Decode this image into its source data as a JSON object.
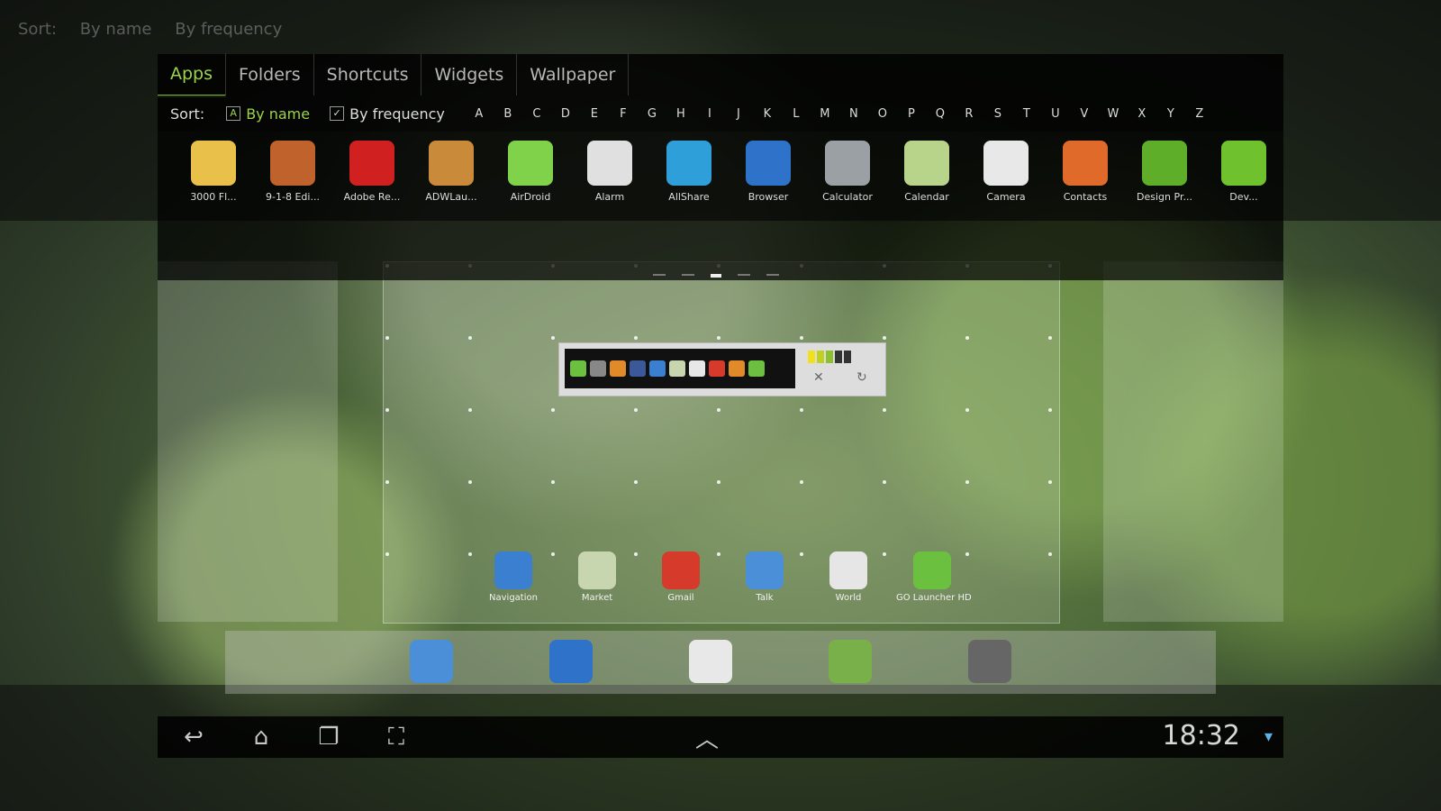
{
  "tabs": [
    "Apps",
    "Folders",
    "Shortcuts",
    "Widgets",
    "Wallpaper"
  ],
  "sort": {
    "label": "Sort:",
    "by_name": "By name",
    "by_frequency": "By frequency",
    "letters": [
      "A",
      "B",
      "C",
      "D",
      "E",
      "F",
      "G",
      "H",
      "I",
      "J",
      "K",
      "L",
      "M",
      "N",
      "O",
      "P",
      "Q",
      "R",
      "S",
      "T",
      "U",
      "V",
      "W",
      "X",
      "Y",
      "Z"
    ]
  },
  "apps": [
    {
      "name": "3000 Fl...",
      "icon": "tablet-icon",
      "color": "#e9c04a"
    },
    {
      "name": "9-1-8 Edi...",
      "icon": "books-icon",
      "color": "#c0622b"
    },
    {
      "name": "Adobe Re...",
      "icon": "pdf-icon",
      "color": "#d02020"
    },
    {
      "name": "ADWLau...",
      "icon": "adw-icon",
      "color": "#c98a3a"
    },
    {
      "name": "AirDroid",
      "icon": "paper-plane-icon",
      "color": "#7fd24a"
    },
    {
      "name": "Alarm",
      "icon": "clock-icon",
      "color": "#e0e0e0"
    },
    {
      "name": "AllShare",
      "icon": "allshare-icon",
      "color": "#2e9fd8"
    },
    {
      "name": "Browser",
      "icon": "globe-icon",
      "color": "#2f72c9"
    },
    {
      "name": "Calculator",
      "icon": "calculator-icon",
      "color": "#9aa0a4"
    },
    {
      "name": "Calendar",
      "icon": "calendar-icon",
      "color": "#b8d48a"
    },
    {
      "name": "Camera",
      "icon": "camera-icon",
      "color": "#e8e8e8"
    },
    {
      "name": "Contacts",
      "icon": "contacts-icon",
      "color": "#e06a2a"
    },
    {
      "name": "Design Pr...",
      "icon": "design-icon",
      "color": "#5fae2a"
    },
    {
      "name": "Dev...",
      "icon": "dev-icon",
      "color": "#6fc12e"
    }
  ],
  "dock_apps": [
    {
      "name": "Navigation",
      "icon": "navigation-icon",
      "color": "#3a7fd0"
    },
    {
      "name": "Market",
      "icon": "market-icon",
      "color": "#c8d6b0"
    },
    {
      "name": "Gmail",
      "icon": "gmail-icon",
      "color": "#d63a2a"
    },
    {
      "name": "Talk",
      "icon": "talk-icon",
      "color": "#4a8fd8"
    },
    {
      "name": "World",
      "icon": "clock-icon",
      "color": "#e6e6e6"
    },
    {
      "name": "GO Launcher HD",
      "icon": "go-launcher-icon",
      "color": "#6cc040"
    }
  ],
  "hotseat": [
    {
      "icon": "settings-icon",
      "color": "#4a8fd8"
    },
    {
      "icon": "globe-icon",
      "color": "#2f72c9"
    },
    {
      "icon": "camera-icon",
      "color": "#e8e8e8"
    },
    {
      "icon": "gallery-icon",
      "color": "#7ab04a"
    },
    {
      "icon": "headphones-icon",
      "color": "#666"
    }
  ],
  "status": {
    "time": "18:32"
  },
  "colors": {
    "accent": "#9dd34a"
  }
}
